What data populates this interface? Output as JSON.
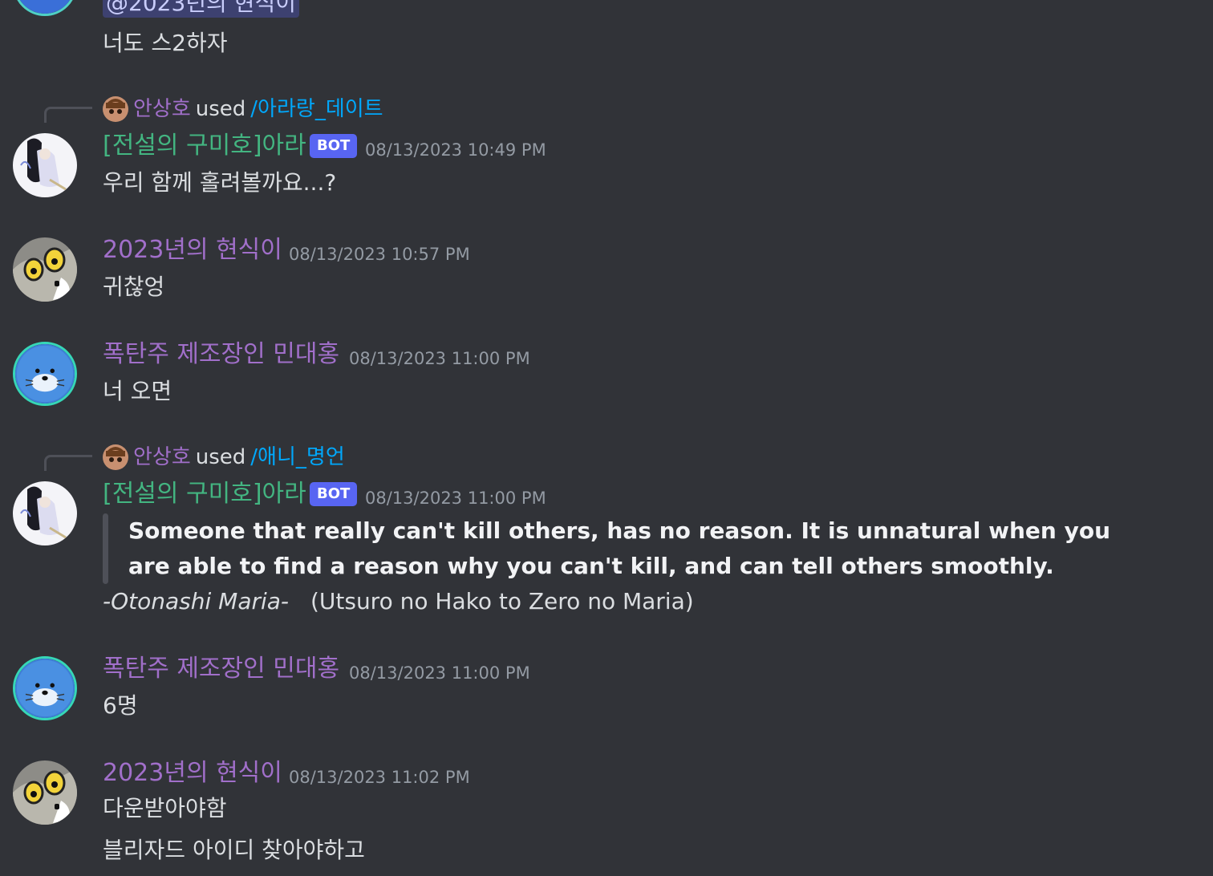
{
  "colors": {
    "background": "#313338",
    "bot_user": "#43b581",
    "human_user": "#a16fca",
    "bot_tag": "#5865f2",
    "command_link": "#00a8fc"
  },
  "top": {
    "mention": "@2023년의 현식이",
    "text": "너도 스2하자"
  },
  "msg1": {
    "cmd_user": "안상호",
    "cmd_used": "used",
    "cmd_name": "/아라랑_데이트",
    "username": "[전설의 구미호]아라",
    "bot_tag": "BOT",
    "timestamp": "08/13/2023 10:49 PM",
    "text": "우리 함께 홀려볼까요...?"
  },
  "msg2": {
    "username": "2023년의 현식이",
    "timestamp": "08/13/2023 10:57 PM",
    "text": "귀찮엉"
  },
  "msg3": {
    "username": "폭탄주 제조장인 민대홍",
    "timestamp": "08/13/2023 11:00 PM",
    "text": "너 오면"
  },
  "msg4": {
    "cmd_user": "안상호",
    "cmd_used": "used",
    "cmd_name": "/애니_명언",
    "username": "[전설의 구미호]아라",
    "bot_tag": "BOT",
    "timestamp": "08/13/2023 11:00 PM",
    "quote": "Someone that really can't kill others, has no reason. It is unnatural when you are able to find a reason why you can't kill, and can tell others smoothly.",
    "attribution_name": "-Otonashi Maria-",
    "attribution_source": "(Utsuro no Hako to Zero no Maria)"
  },
  "msg5": {
    "username": "폭탄주 제조장인 민대홍",
    "timestamp": "08/13/2023 11:00 PM",
    "text": "6명"
  },
  "msg6": {
    "username": "2023년의 현식이",
    "timestamp": "08/13/2023 11:02 PM",
    "text": "다운받아야함",
    "text2": "블리자드 아이디 찾아야하고"
  }
}
